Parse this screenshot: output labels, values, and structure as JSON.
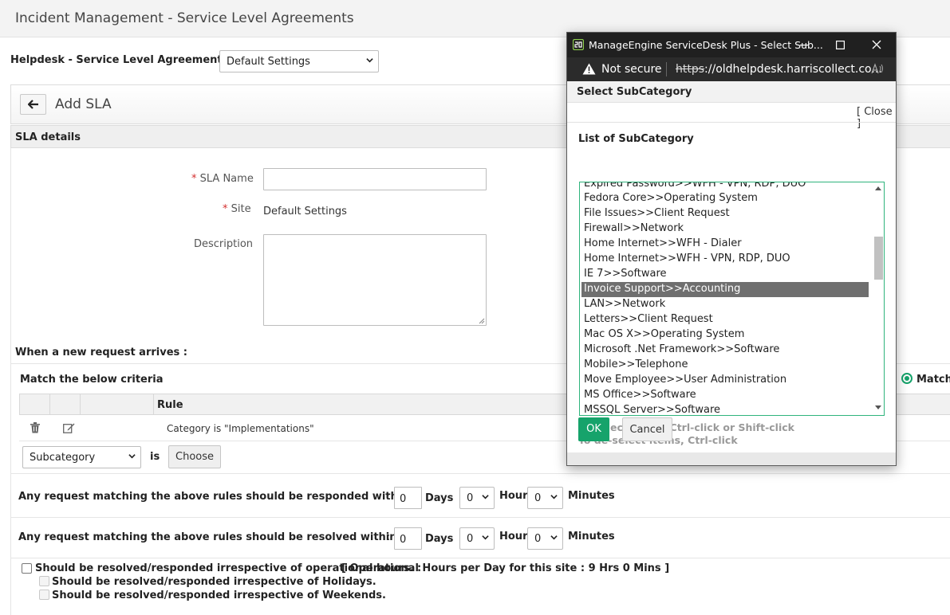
{
  "page": {
    "title": "Incident Management - Service Level Agreements",
    "helpdesk_label": "Helpdesk - Service Level Agreements for",
    "helpdesk_select": "Default Settings",
    "add_sla_title": "Add SLA",
    "sla_details_label": "SLA details"
  },
  "form": {
    "sla_name_label": "SLA Name",
    "site_label": "Site",
    "site_value": "Default Settings",
    "description_label": "Description",
    "required_marker": "*"
  },
  "criteria": {
    "new_request_label": "When a new request arrives :",
    "match_label": "Match the below criteria",
    "match_radio_label": "Match A",
    "rule_header": "Rule",
    "rule_text": "Category is \"Implementations\"",
    "field_select": "Subcategory",
    "is_label": "is",
    "choose_label": "Choose"
  },
  "response": {
    "responded_label": "Any request matching the above rules should be responded within",
    "resolved_label": "Any request matching the above rules should be resolved within",
    "colon": ":",
    "days_value": "0",
    "days_label": "Days",
    "hours_value": "0",
    "hours_label": "Hours",
    "minutes_value": "0",
    "minutes_label": "Minutes"
  },
  "operational": {
    "main_label": "Should be resolved/responded irrespective of operational hours. :",
    "hours_info": "[ Operational Hours per Day for this site :  9 Hrs 0 Mins ]",
    "holidays_label": "Should be resolved/responded irrespective of Holidays.",
    "weekends_label": "Should be resolved/responded irrespective of Weekends."
  },
  "popup": {
    "window_title": "ManageEngine ServiceDesk Plus - Select Sub...",
    "security_label": "Not secure",
    "url_prefix": "https",
    "url_rest": "://oldhelpdesk.harriscollect.co...",
    "header": "Select SubCategory",
    "close_link": "[ Close ]",
    "list_title": "List of SubCategory",
    "items": [
      "Expired Password>>WFH - VPN, RDP, DUO",
      "Fedora Core>>Operating System",
      "File Issues>>Client Request",
      "Firewall>>Network",
      "Home Internet>>WFH - Dialer",
      "Home Internet>>WFH - VPN, RDP, DUO",
      "IE 7>>Software",
      "Invoice Support>>Accounting",
      "LAN>>Network",
      "Letters>>Client Request",
      "Mac OS X>>Operating System",
      "Microsoft .Net Framework>>Software",
      "Mobile>>Telephone",
      "Move Employee>>User Administration",
      "MS Office>>Software",
      "MSSQL Server>>Software"
    ],
    "selected_item": "Invoice Support>>Accounting",
    "hint_select": "To select items, Ctrl-click or Shift-click",
    "hint_deselect": "To de-select items, Ctrl-click",
    "ok_label": "OK",
    "cancel_label": "Cancel"
  },
  "colors": {
    "accent_green": "#16a36b",
    "list_border": "#2fb47c",
    "selection_gray": "#6f6f6f",
    "required_red": "#d32f2f"
  }
}
